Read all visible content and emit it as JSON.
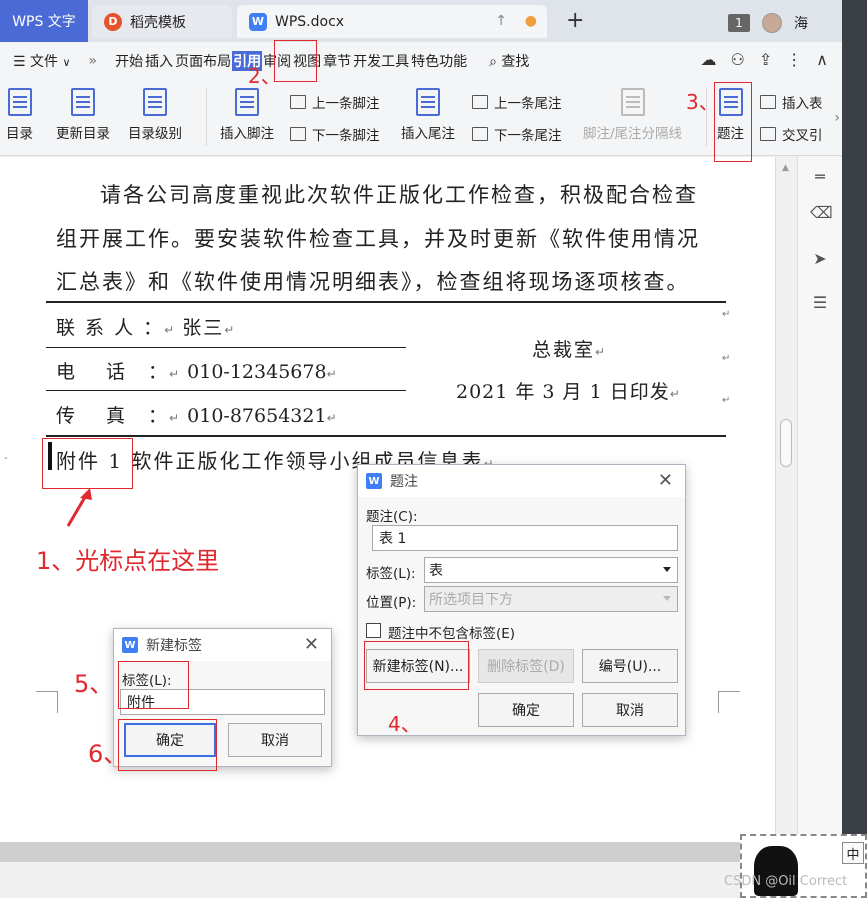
{
  "tabs": {
    "wps": "WPS 文字",
    "template": "稻壳模板",
    "doc": "WPS.docx"
  },
  "titlebar": {
    "window_count": "1",
    "user": "海"
  },
  "menu": {
    "file": "文件",
    "items": [
      "开始",
      "插入",
      "页面布局",
      "引用",
      "审阅",
      "视图",
      "章节",
      "开发工具",
      "特色功能"
    ],
    "find": "查找"
  },
  "ribbon": {
    "toc": "目录",
    "update_toc": "更新目录",
    "toc_level": "目录级别",
    "insert_footnote": "插入脚注",
    "prev_footnote": "上一条脚注",
    "next_footnote": "下一条脚注",
    "insert_endnote": "插入尾注",
    "prev_endnote": "上一条尾注",
    "next_endnote": "下一条尾注",
    "separator": "脚注/尾注分隔线",
    "caption": "题注",
    "insert_table": "插入表",
    "cross_ref": "交叉引"
  },
  "document": {
    "para1": "请各公司高度重视此次软件正版化工作检查，积极配合检查",
    "para2": "组开展工作。要安装软件检查工具，并及时更新《软件使用情况",
    "para3": "汇总表》和《软件使用情况明细表》，检查组将现场逐项核查。",
    "contact_label": "联 系 人 ：",
    "contact_value": "张三",
    "phone_label": "电　 话　：",
    "phone_value": "010-12345678",
    "fax_label": "传　 真　：",
    "fax_value": "010-87654321",
    "office": "总裁室",
    "date": "2021 年 3 月 1 日印发",
    "attachment_label": "附件 1",
    "attachment_text": "软件正版化工作领导小组成员信息表"
  },
  "annotations": {
    "step1": "1、光标点在这里",
    "step2": "2、",
    "step3": "3、",
    "step4": "4、",
    "step5": "5、",
    "step6": "6、"
  },
  "caption_dialog": {
    "title": "题注",
    "caption_label": "题注(C):",
    "caption_value": "表 1",
    "label_label": "标签(L):",
    "label_value": "表",
    "position_label": "位置(P):",
    "position_value": "所选项目下方",
    "exclude_label": "题注中不包含标签(E)",
    "new_label_btn": "新建标签(N)...",
    "delete_label_btn": "删除标签(D)",
    "numbering_btn": "编号(U)...",
    "ok": "确定",
    "cancel": "取消"
  },
  "new_label_dialog": {
    "title": "新建标签",
    "label_label": "标签(L):",
    "label_value": "附件",
    "ok": "确定",
    "cancel": "取消"
  },
  "ime": {
    "lang": "中"
  },
  "watermark": "CSDN @Oil Correct"
}
